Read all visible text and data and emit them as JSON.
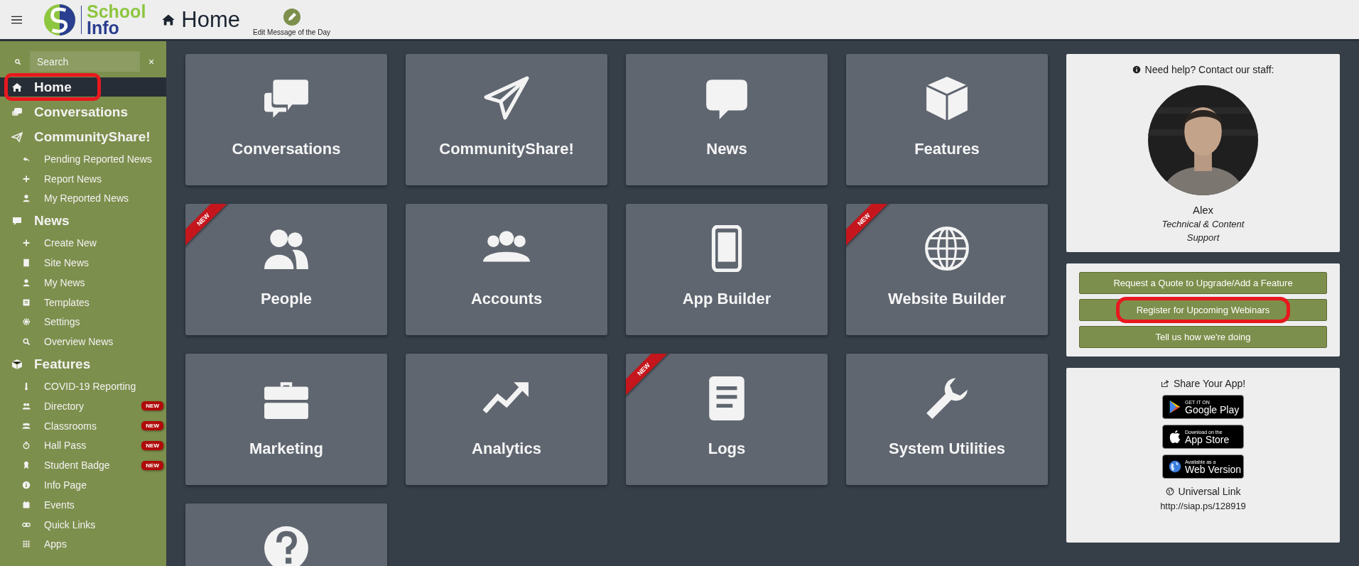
{
  "topbar": {
    "logo": {
      "line1": "School",
      "line2": "Info"
    },
    "page_title": "Home",
    "motd_label": "Edit Message of the Day"
  },
  "sidebar": {
    "search": {
      "placeholder": "Search"
    },
    "clear": "×",
    "items": [
      {
        "label": "Home",
        "kind": "house",
        "selected": true,
        "annotated": true
      },
      {
        "label": "Conversations",
        "kind": "chat",
        "selected": false,
        "annotated": false
      },
      {
        "label": "CommunityShare!",
        "kind": "plane",
        "selected": false,
        "annotated": false,
        "children": [
          {
            "label": "Pending Reported News",
            "kind": "reply"
          },
          {
            "label": "Report News",
            "kind": "plus"
          },
          {
            "label": "My Reported News",
            "kind": "person"
          }
        ]
      },
      {
        "label": "News",
        "kind": "bubble",
        "selected": false,
        "annotated": false,
        "children": [
          {
            "label": "Create New",
            "kind": "plus"
          },
          {
            "label": "Site News",
            "kind": "building"
          },
          {
            "label": "My News",
            "kind": "person"
          },
          {
            "label": "Templates",
            "kind": "list"
          },
          {
            "label": "Settings",
            "kind": "gear"
          },
          {
            "label": "Overview News",
            "kind": "search"
          }
        ]
      },
      {
        "label": "Features",
        "kind": "cube",
        "selected": false,
        "annotated": false,
        "children": [
          {
            "label": "COVID-19 Reporting",
            "kind": "thermometer"
          },
          {
            "label": "Directory",
            "kind": "people",
            "badge": "NEW"
          },
          {
            "label": "Classrooms",
            "kind": "group",
            "badge": "NEW"
          },
          {
            "label": "Hall Pass",
            "kind": "stopwatch",
            "badge": "NEW"
          },
          {
            "label": "Student Badge",
            "kind": "medal",
            "badge": "NEW"
          },
          {
            "label": "Info Page",
            "kind": "info"
          },
          {
            "label": "Events",
            "kind": "calendar"
          },
          {
            "label": "Quick Links",
            "kind": "link"
          },
          {
            "label": "Apps",
            "kind": "grid"
          }
        ]
      }
    ]
  },
  "tiles": [
    {
      "label": "Conversations",
      "kind": "chat"
    },
    {
      "label": "CommunityShare!",
      "kind": "plane"
    },
    {
      "label": "News",
      "kind": "bubble"
    },
    {
      "label": "Features",
      "kind": "cube"
    },
    {
      "label": "People",
      "kind": "people",
      "ribbon": "NEW"
    },
    {
      "label": "Accounts",
      "kind": "group"
    },
    {
      "label": "App Builder",
      "kind": "phone"
    },
    {
      "label": "Website Builder",
      "kind": "globe",
      "ribbon": "NEW"
    },
    {
      "label": "Marketing",
      "kind": "briefcase"
    },
    {
      "label": "Analytics",
      "kind": "trend"
    },
    {
      "label": "Logs",
      "kind": "document",
      "ribbon": "NEW"
    },
    {
      "label": "System Utilities",
      "kind": "wrench"
    },
    {
      "kind": "question"
    }
  ],
  "help_card": {
    "heading": "Need help? Contact our staff:",
    "name": "Alex",
    "role": "Technical & Content Support"
  },
  "action_buttons": [
    {
      "label": "Request a Quote to Upgrade/Add a Feature",
      "annotated": false
    },
    {
      "label": "Register for Upcoming Webinars",
      "annotated": true
    },
    {
      "label": "Tell us how we're doing",
      "annotated": false
    }
  ],
  "share_card": {
    "heading": "Share Your App!",
    "badges": [
      {
        "kind": "google",
        "small": "GET IT ON",
        "big": "Google Play"
      },
      {
        "kind": "apple",
        "small": "Download on the",
        "big": "App Store"
      },
      {
        "kind": "web",
        "small": "Available as a",
        "big": "Web Version"
      }
    ],
    "link_label": "Universal Link",
    "link": "http://siap.ps/128919"
  }
}
